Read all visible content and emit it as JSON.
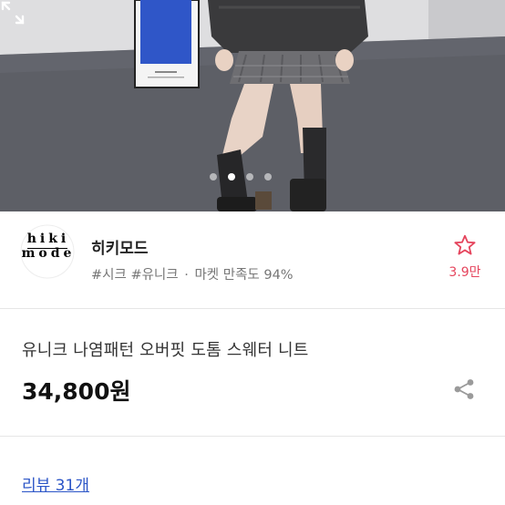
{
  "gallery": {
    "dot_count": 4,
    "active_index": 1,
    "expand_icon": "expand-icon"
  },
  "shop": {
    "logo_line1": "hiki",
    "logo_line2": "mode",
    "logo_url_text": "www.hikimode.kr",
    "name": "히키모드",
    "tags": "#시크 #유니크",
    "separator": "·",
    "satisfaction": "마켓 만족도 94%",
    "favorite_count": "3.9만",
    "favorite_icon": "star-outline-icon",
    "accent_color": "#e5455d"
  },
  "product": {
    "title": "유니크 나염패턴 오버핏 도톰 스웨터 니트",
    "price": "34,800원",
    "share_icon": "share-icon"
  },
  "review": {
    "label": "리뷰 31개",
    "link_color": "#2b55c7"
  }
}
